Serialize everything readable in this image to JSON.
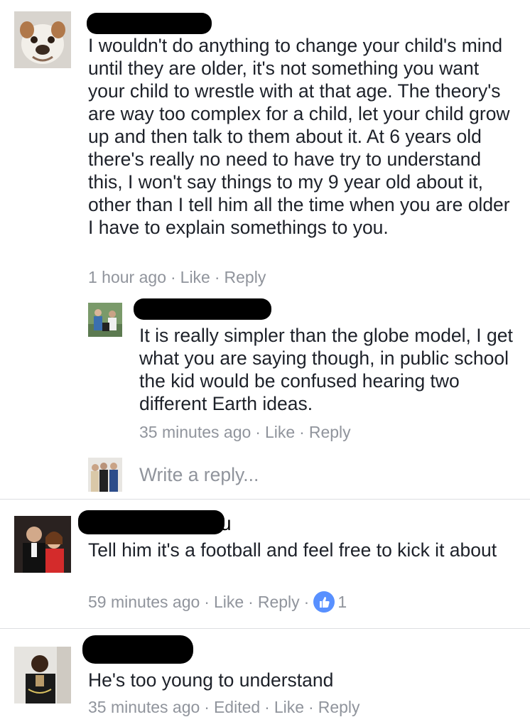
{
  "comments": [
    {
      "text": "I wouldn't do anything to change your child's mind until they are older, it's not something you want your child to wrestle with at that age. The theory's are way too complex for a child, let your child grow up and then talk to them about it. At 6 years old there's really no need to have try to understand this, I won't say things to my 9 year old about it, other than I tell him all the time when you are older I have to explain somethings to you.",
      "time": "1 hour ago",
      "like": "Like",
      "reply": "Reply",
      "reply_item": {
        "text": "It is really simpler than the globe model, I get what you are saying though, in public school the kid would be confused hearing two different Earth ideas.",
        "time": "35 minutes ago",
        "like": "Like",
        "reply": "Reply"
      },
      "reply_box_placeholder": "Write a reply..."
    },
    {
      "name_visible": "u",
      "text": "Tell him it's a football and feel free to kick it about",
      "time": "59 minutes ago",
      "like": "Like",
      "reply": "Reply",
      "reaction_count": "1"
    },
    {
      "text": "He's too young to understand",
      "time": "35 minutes ago",
      "edited": "Edited",
      "like": "Like",
      "reply": "Reply"
    }
  ],
  "separator": "·",
  "colors": {
    "text": "#1d2129",
    "meta": "#90949c",
    "divider": "#dddfe2",
    "like_blue": "#5890ff"
  }
}
